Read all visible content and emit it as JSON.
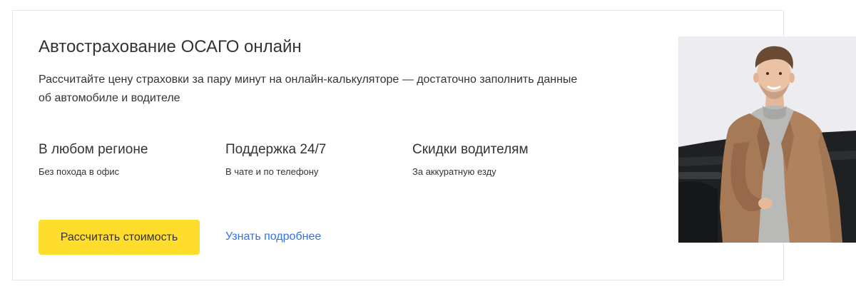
{
  "card": {
    "title": "Автострахование ОСАГО онлайн",
    "description": "Рассчитайте цену страховки за пару минут на онлайн-калькуляторе — достаточно заполнить данные об автомобиле и водителе",
    "features": [
      {
        "title": "В любом регионе",
        "subtitle": "Без похода в офис"
      },
      {
        "title": "Поддержка 24/7",
        "subtitle": "В чате и по телефону"
      },
      {
        "title": "Скидки водителям",
        "subtitle": "За аккуратную езду"
      }
    ],
    "primary_button": "Рассчитать стоимость",
    "secondary_link": "Узнать подробнее"
  },
  "colors": {
    "accent_yellow": "#ffdd2d",
    "link_blue": "#336fee",
    "text": "#333333"
  },
  "image": {
    "subject": "man-in-brown-jacket-with-car"
  }
}
